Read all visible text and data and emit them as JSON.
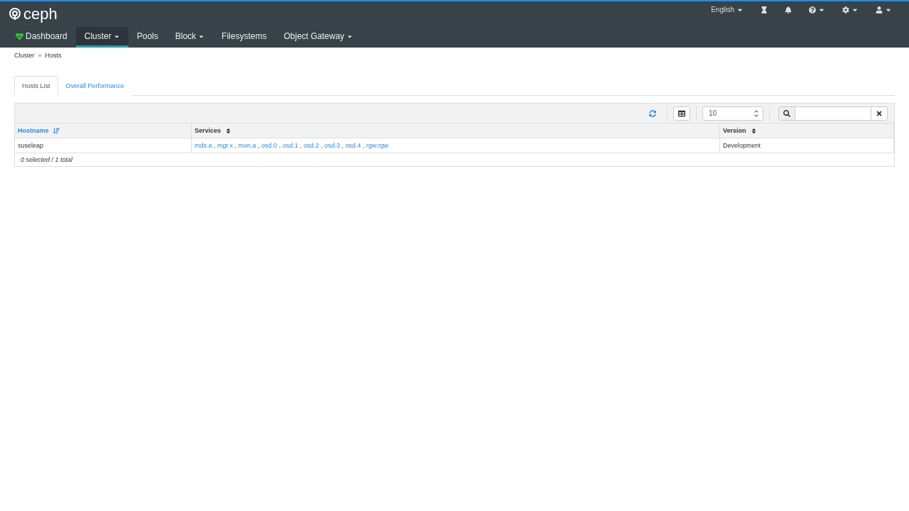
{
  "brand": "ceph",
  "top_menu": {
    "language": "English"
  },
  "nav": [
    {
      "label": "Dashboard",
      "kind": "health",
      "selected": false
    },
    {
      "label": "Cluster",
      "kind": "dropdown",
      "selected": true
    },
    {
      "label": "Pools",
      "kind": "link",
      "selected": false
    },
    {
      "label": "Block",
      "kind": "dropdown",
      "selected": false
    },
    {
      "label": "Filesystems",
      "kind": "link",
      "selected": false
    },
    {
      "label": "Object Gateway",
      "kind": "dropdown",
      "selected": false
    }
  ],
  "breadcrumb": [
    "Cluster",
    "Hosts"
  ],
  "breadcrumb_separator": "»",
  "tabs": [
    {
      "label": "Hosts List",
      "selected": true
    },
    {
      "label": "Overall Performance",
      "selected": false
    }
  ],
  "table": {
    "page_size": "10",
    "columns": [
      {
        "label": "Hostname",
        "sorted": true
      },
      {
        "label": "Services",
        "sorted": false
      },
      {
        "label": "Version",
        "sorted": false
      }
    ],
    "service_separator": ",",
    "rows": [
      {
        "hostname": "suseleap",
        "services": [
          "mds.a",
          "mgr.x",
          "mon.a",
          "osd.0",
          "osd.1",
          "osd.2",
          "osd.3",
          "osd.4",
          "rgw.rgw"
        ],
        "version": "Development"
      }
    ],
    "footer": "0 selected / 1 total"
  }
}
